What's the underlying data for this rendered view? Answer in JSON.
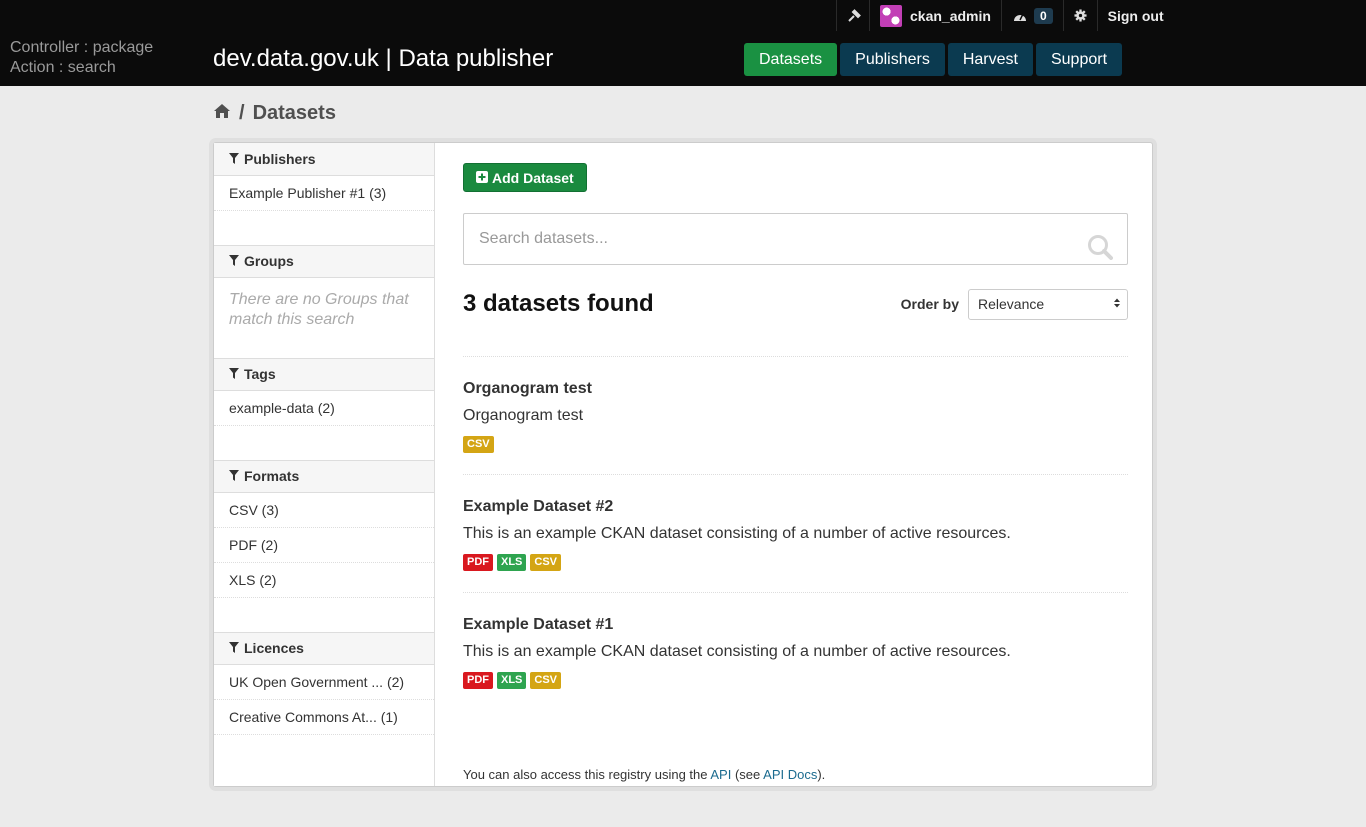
{
  "debug": {
    "controller": "Controller : package",
    "action": "Action : search"
  },
  "site": {
    "title": "dev.data.gov.uk | Data publisher"
  },
  "account": {
    "username": "ckan_admin",
    "dashboard_count": "0",
    "signout": "Sign out"
  },
  "nav": [
    {
      "label": "Datasets",
      "active": true
    },
    {
      "label": "Publishers",
      "active": false
    },
    {
      "label": "Harvest",
      "active": false
    },
    {
      "label": "Support",
      "active": false
    }
  ],
  "breadcrumb": {
    "separator": "/",
    "current": "Datasets"
  },
  "facets": {
    "publishers": {
      "title": "Publishers",
      "items": [
        "Example Publisher #1 (3)"
      ]
    },
    "groups": {
      "title": "Groups",
      "empty": "There are no Groups that match this search"
    },
    "tags": {
      "title": "Tags",
      "items": [
        "example-data (2)"
      ]
    },
    "formats": {
      "title": "Formats",
      "items": [
        "CSV (3)",
        "PDF (2)",
        "XLS (2)"
      ]
    },
    "licences": {
      "title": "Licences",
      "items": [
        "UK Open Government ... (2)",
        "Creative Commons At... (1)"
      ]
    }
  },
  "actions": {
    "add_dataset": "Add Dataset"
  },
  "search": {
    "placeholder": "Search datasets...",
    "value": ""
  },
  "results": {
    "count_text": "3 datasets found",
    "order_label": "Order by",
    "order_selected": "Relevance"
  },
  "datasets": [
    {
      "title": "Organogram test",
      "description": "Organogram test",
      "formats": [
        "CSV"
      ]
    },
    {
      "title": "Example Dataset #2",
      "description": "This is an example CKAN dataset consisting of a number of active resources.",
      "formats": [
        "PDF",
        "XLS",
        "CSV"
      ]
    },
    {
      "title": "Example Dataset #1",
      "description": "This is an example CKAN dataset consisting of a number of active resources.",
      "formats": [
        "PDF",
        "XLS",
        "CSV"
      ]
    }
  ],
  "format_colors": {
    "CSV": "#d4a514",
    "PDF": "#d9181f",
    "XLS": "#2ea44f"
  },
  "footer": {
    "prefix": "You can also access this registry using the ",
    "api_link": "API",
    "middle": " (see ",
    "docs_link": "API Docs",
    "suffix": ")."
  }
}
